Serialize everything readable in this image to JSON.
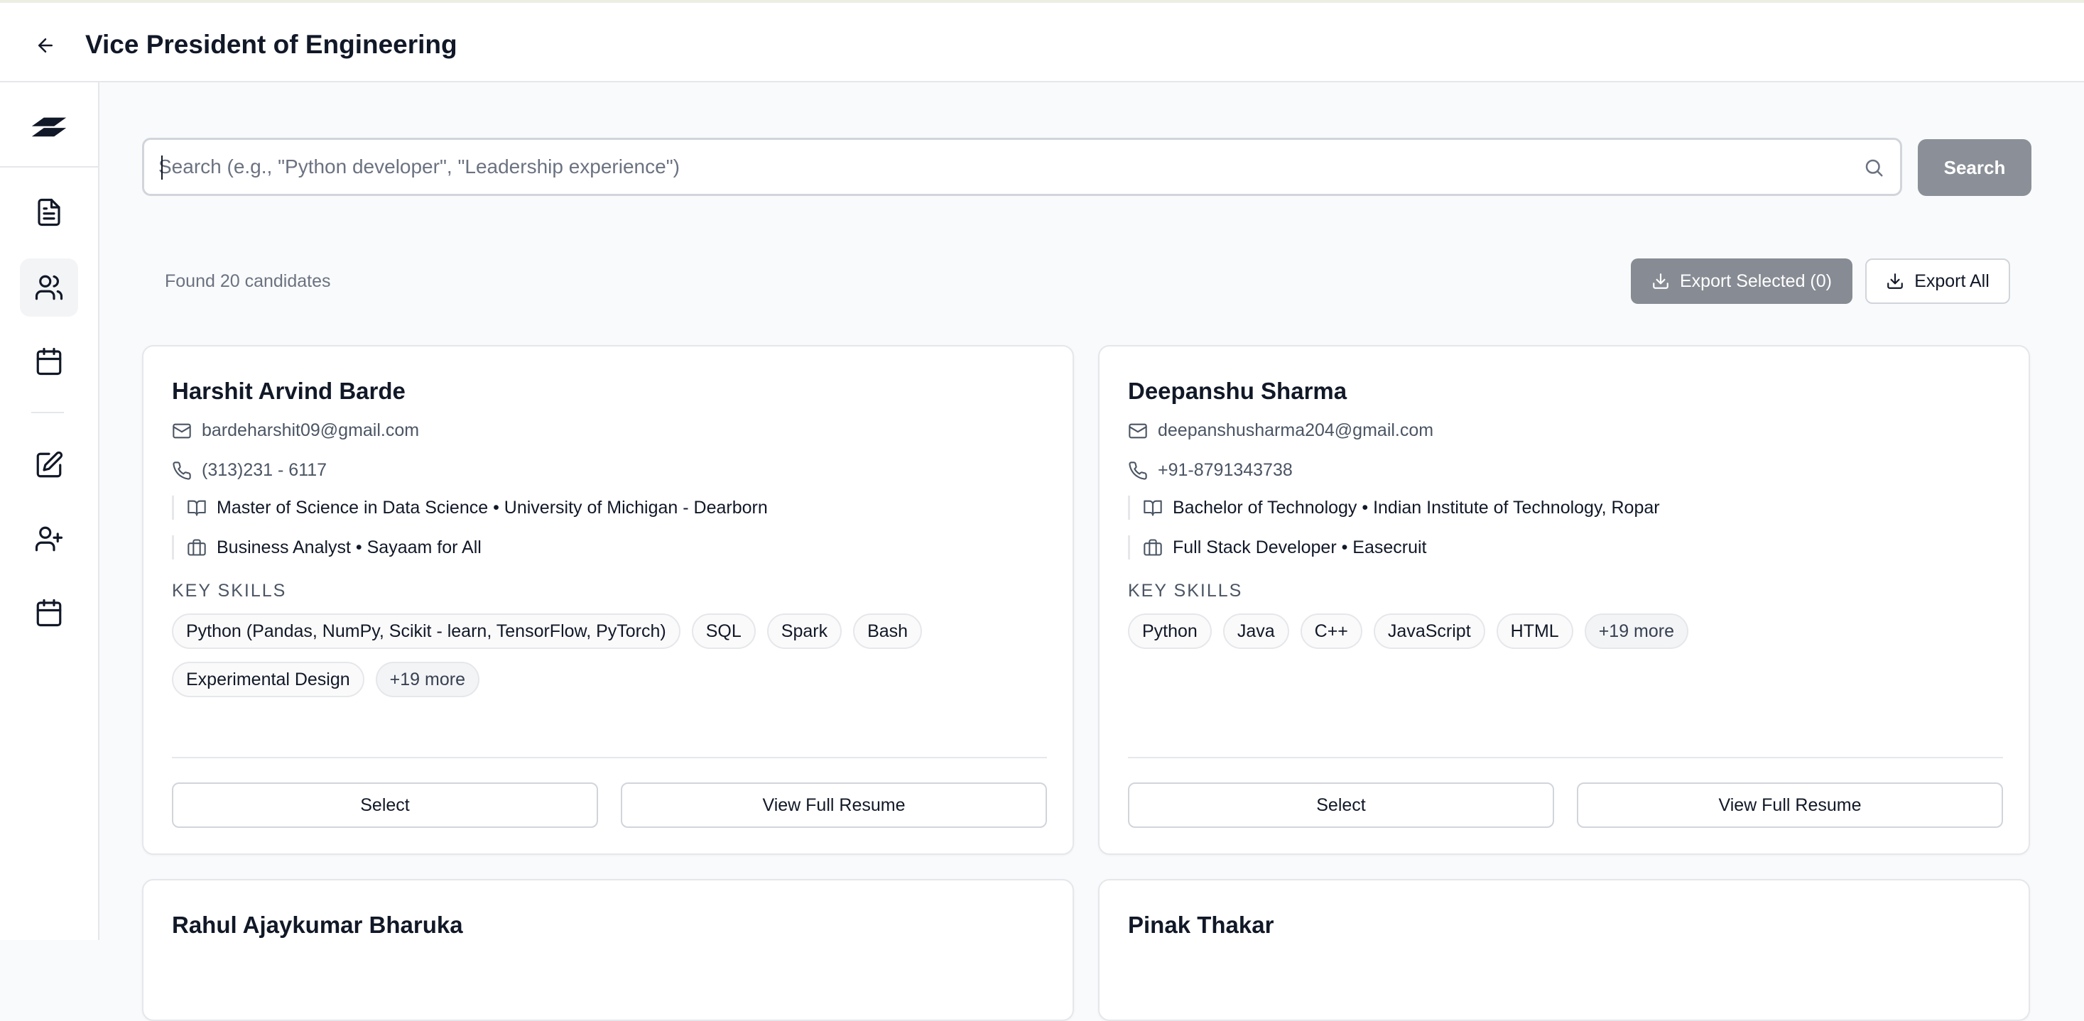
{
  "header": {
    "title": "Vice President of Engineering"
  },
  "search": {
    "placeholder": "Search (e.g., \"Python developer\", \"Leadership experience\")",
    "button_label": "Search"
  },
  "results": {
    "found_text": "Found 20 candidates",
    "export_selected_label": "Export Selected (0)",
    "export_all_label": "Export All"
  },
  "sidebar": {
    "items": [
      {
        "icon": "document-icon"
      },
      {
        "icon": "users-icon",
        "active": true
      },
      {
        "icon": "calendar-icon"
      },
      {
        "icon": "edit-icon"
      },
      {
        "icon": "user-plus-icon"
      },
      {
        "icon": "calendar-icon"
      }
    ]
  },
  "labels": {
    "key_skills": "KEY SKILLS",
    "select": "Select",
    "view_resume": "View Full Resume"
  },
  "candidates": [
    {
      "name": "Harshit Arvind Barde",
      "email": "bardeharshit09@gmail.com",
      "phone": "(313)231 - 6117",
      "education": "Master of Science in Data Science • University of Michigan - Dearborn",
      "experience": "Business Analyst • Sayaam for All",
      "skills": [
        "Python (Pandas, NumPy, Scikit - learn, TensorFlow, PyTorch)",
        "SQL",
        "Spark",
        "Bash",
        "Experimental Design"
      ],
      "more": "+19 more"
    },
    {
      "name": "Deepanshu Sharma",
      "email": "deepanshusharma204@gmail.com",
      "phone": "+91-8791343738",
      "education": "Bachelor of Technology • Indian Institute of Technology, Ropar",
      "experience": "Full Stack Developer • Easecruit",
      "skills": [
        "Python",
        "Java",
        "C++",
        "JavaScript",
        "HTML"
      ],
      "more": "+19 more"
    },
    {
      "name": "Rahul Ajaykumar Bharuka"
    },
    {
      "name": "Pinak Thakar"
    }
  ],
  "colors": {
    "accent_button": "#8b9098",
    "border": "#e5e7eb",
    "muted_text": "#6b7280"
  }
}
